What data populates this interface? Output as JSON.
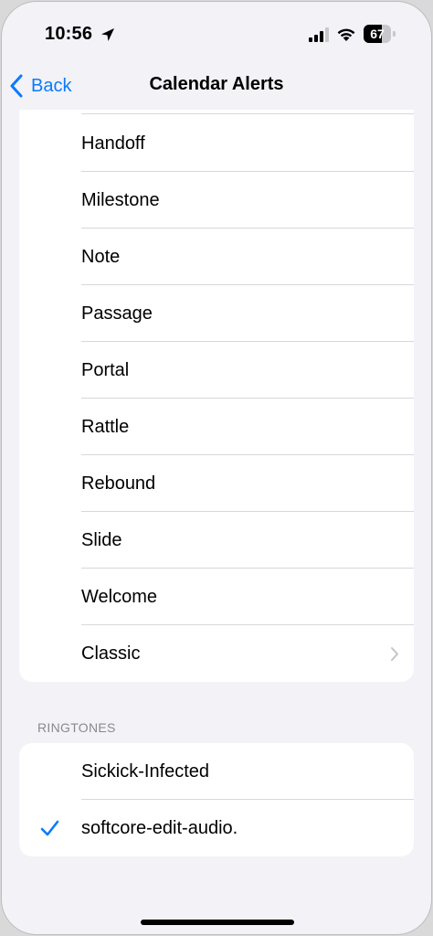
{
  "status_bar": {
    "time": "10:56",
    "battery_level": "67",
    "battery_fraction": 0.67,
    "icons": [
      "location-arrow-icon",
      "cellular-signal-icon",
      "wifi-icon",
      "battery-icon"
    ]
  },
  "nav": {
    "back_label": "Back",
    "title": "Calendar Alerts"
  },
  "alert_tones": {
    "items": [
      {
        "label": "Handoff"
      },
      {
        "label": "Milestone"
      },
      {
        "label": "Note"
      },
      {
        "label": "Passage"
      },
      {
        "label": "Portal"
      },
      {
        "label": "Rattle"
      },
      {
        "label": "Rebound"
      },
      {
        "label": "Slide"
      },
      {
        "label": "Welcome"
      },
      {
        "label": "Classic",
        "has_disclosure": true
      }
    ]
  },
  "ringtones": {
    "header": "RINGTONES",
    "items": [
      {
        "label": "Sickick-Infected",
        "selected": false
      },
      {
        "label": "softcore-edit-audio.",
        "selected": true
      }
    ]
  },
  "colors": {
    "accent": "#0a7aff",
    "background": "#f2f2f7",
    "card": "#ffffff",
    "separator": "#d8d8dc",
    "secondary_text": "#8a8a8e"
  }
}
